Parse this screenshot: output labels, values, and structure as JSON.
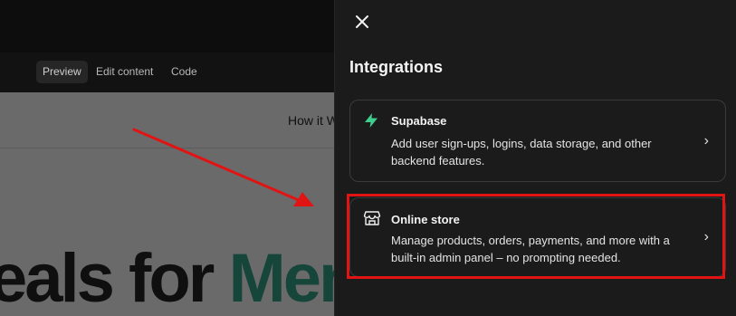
{
  "toolbar": {
    "preview_label": "Preview",
    "edit_label": "Edit content",
    "code_label": "Code"
  },
  "preview": {
    "nav_link": "How it W",
    "hero_text": "eals for ",
    "hero_accent": "Memb"
  },
  "drawer": {
    "title": "Integrations",
    "close_icon": "close-icon",
    "items": [
      {
        "title": "Supabase",
        "description": "Add user sign-ups, logins, data storage, and other backend features.",
        "icon": "supabase-bolt-icon",
        "chevron": "›"
      },
      {
        "title": "Online store",
        "description": "Manage products, orders, payments, and more with a built-in admin panel – no prompting needed.",
        "icon": "storefront-icon",
        "chevron": "›"
      }
    ]
  },
  "annotation": {
    "arrow_color": "#e11414",
    "box_color": "#e11414"
  },
  "colors": {
    "background": "#0d0d0d",
    "drawer": "#1b1b1b",
    "supabase_green": "#3ecf8e",
    "hero_accent": "#16453a"
  }
}
